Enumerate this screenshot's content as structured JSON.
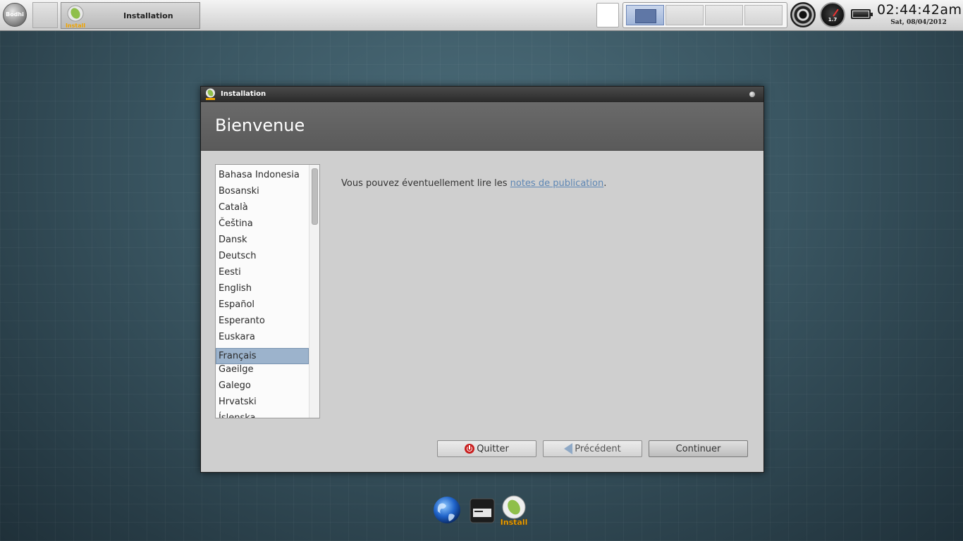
{
  "panel": {
    "start_label": "Bodhi",
    "task_title": "Installation",
    "install_icon_label": "Install",
    "cpu_value": "1.7",
    "clock_time": "02:44:42am",
    "clock_date": "Sat, 08/04/2012"
  },
  "window": {
    "title": "Installation",
    "heading": "Bienvenue",
    "languages": [
      "Bahasa Indonesia",
      "Bosanski",
      "Català",
      "Čeština",
      "Dansk",
      "Deutsch",
      "Eesti",
      "English",
      "Español",
      "Esperanto",
      "Euskara",
      "Français",
      "Gaeilge",
      "Galego",
      "Hrvatski",
      "Íslenska"
    ],
    "selected_language": "Français",
    "notes_prefix": "Vous pouvez éventuellement lire les ",
    "notes_link": "notes de publication",
    "notes_suffix": ".",
    "buttons": {
      "quit": "Quitter",
      "previous": "Précédent",
      "continue": "Continuer"
    }
  },
  "dock": {
    "install_label": "Install"
  },
  "colors": {
    "selection": "#9cb3cc",
    "link": "#5d86b4",
    "quit_red": "#c91d1d"
  }
}
